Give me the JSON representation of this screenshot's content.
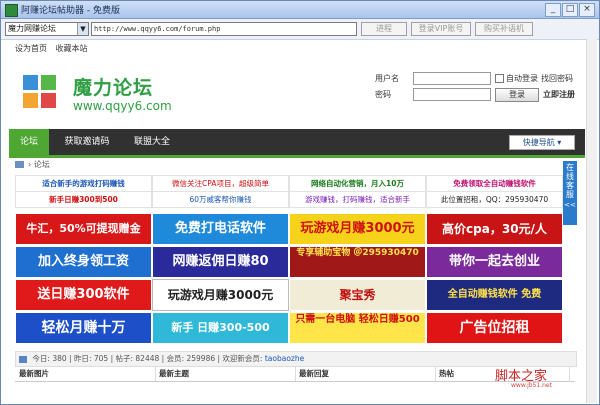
{
  "window": {
    "title": "阿赚论坛帖助器 - 免费版"
  },
  "toolbar": {
    "forum_select": "魔力网赚论坛",
    "address": "http://www.qqyy6.com/forum.php",
    "buttons": [
      "进程",
      "登录VIP账号",
      "购买补语机"
    ]
  },
  "top_links": [
    "设为首页",
    "收藏本站"
  ],
  "logo": {
    "title": "魔力论坛",
    "url": "www.qqyy6.com"
  },
  "login": {
    "username_label": "用户名",
    "password_label": "密码",
    "auto_login": "自动登录",
    "find_password": "找回密码",
    "login_button": "登录",
    "register": "立即注册"
  },
  "nav": {
    "items": [
      "论坛",
      "获取邀请码",
      "联盟大全"
    ],
    "quick": "快捷导航"
  },
  "breadcrumb": "论坛",
  "text_links": [
    [
      "适合新手的游戏打码赚钱",
      "微信关注CPA项目，超级简单",
      "网络自动化营销，月入10万",
      "免费领取全自动赚钱软件"
    ],
    [
      "新手日赚300到500",
      "60万威客帮你赚钱",
      "游戏赚钱，打码赚钱，适合新手",
      "此位置招租，QQ：295930470"
    ]
  ],
  "banners": [
    [
      "牛汇，50%可提现赠金",
      "免费打电话软件",
      "玩游戏月赚3000元",
      "高价cpa，30元/人"
    ],
    [
      "加入终身领工资",
      "网赚返佣日赚80",
      "专享辅助宝物 ＠295930470",
      "带你一起去创业"
    ],
    [
      "送日赚300软件",
      "玩游戏月赚3000元",
      "聚宝秀",
      "全自动赚钱软件 免费"
    ],
    [
      "轻松月赚十万",
      "新手 日赚300-500",
      "只需一台电脑 轻松日赚500",
      "广告位招租"
    ]
  ],
  "stats": {
    "today_label": "今日",
    "today": "380",
    "yesterday_label": "昨日",
    "yesterday": "705",
    "posts_label": "帖子",
    "posts": "82448",
    "members_label": "会员",
    "members": "259986",
    "welcome_label": "欢迎新会员",
    "newest": "taobaozhe"
  },
  "sections": [
    "最新图片",
    "最新主题",
    "最新回复",
    "热帖"
  ],
  "sidebar": {
    "text": "在线客服",
    "arrow": "<<"
  },
  "watermark": {
    "main": "脚本之家",
    "sub": "www.jb51.net"
  },
  "colors": {
    "nav_bg": "#313131",
    "nav_accent": "#4ea633",
    "logo_green": "#2f9e44"
  }
}
